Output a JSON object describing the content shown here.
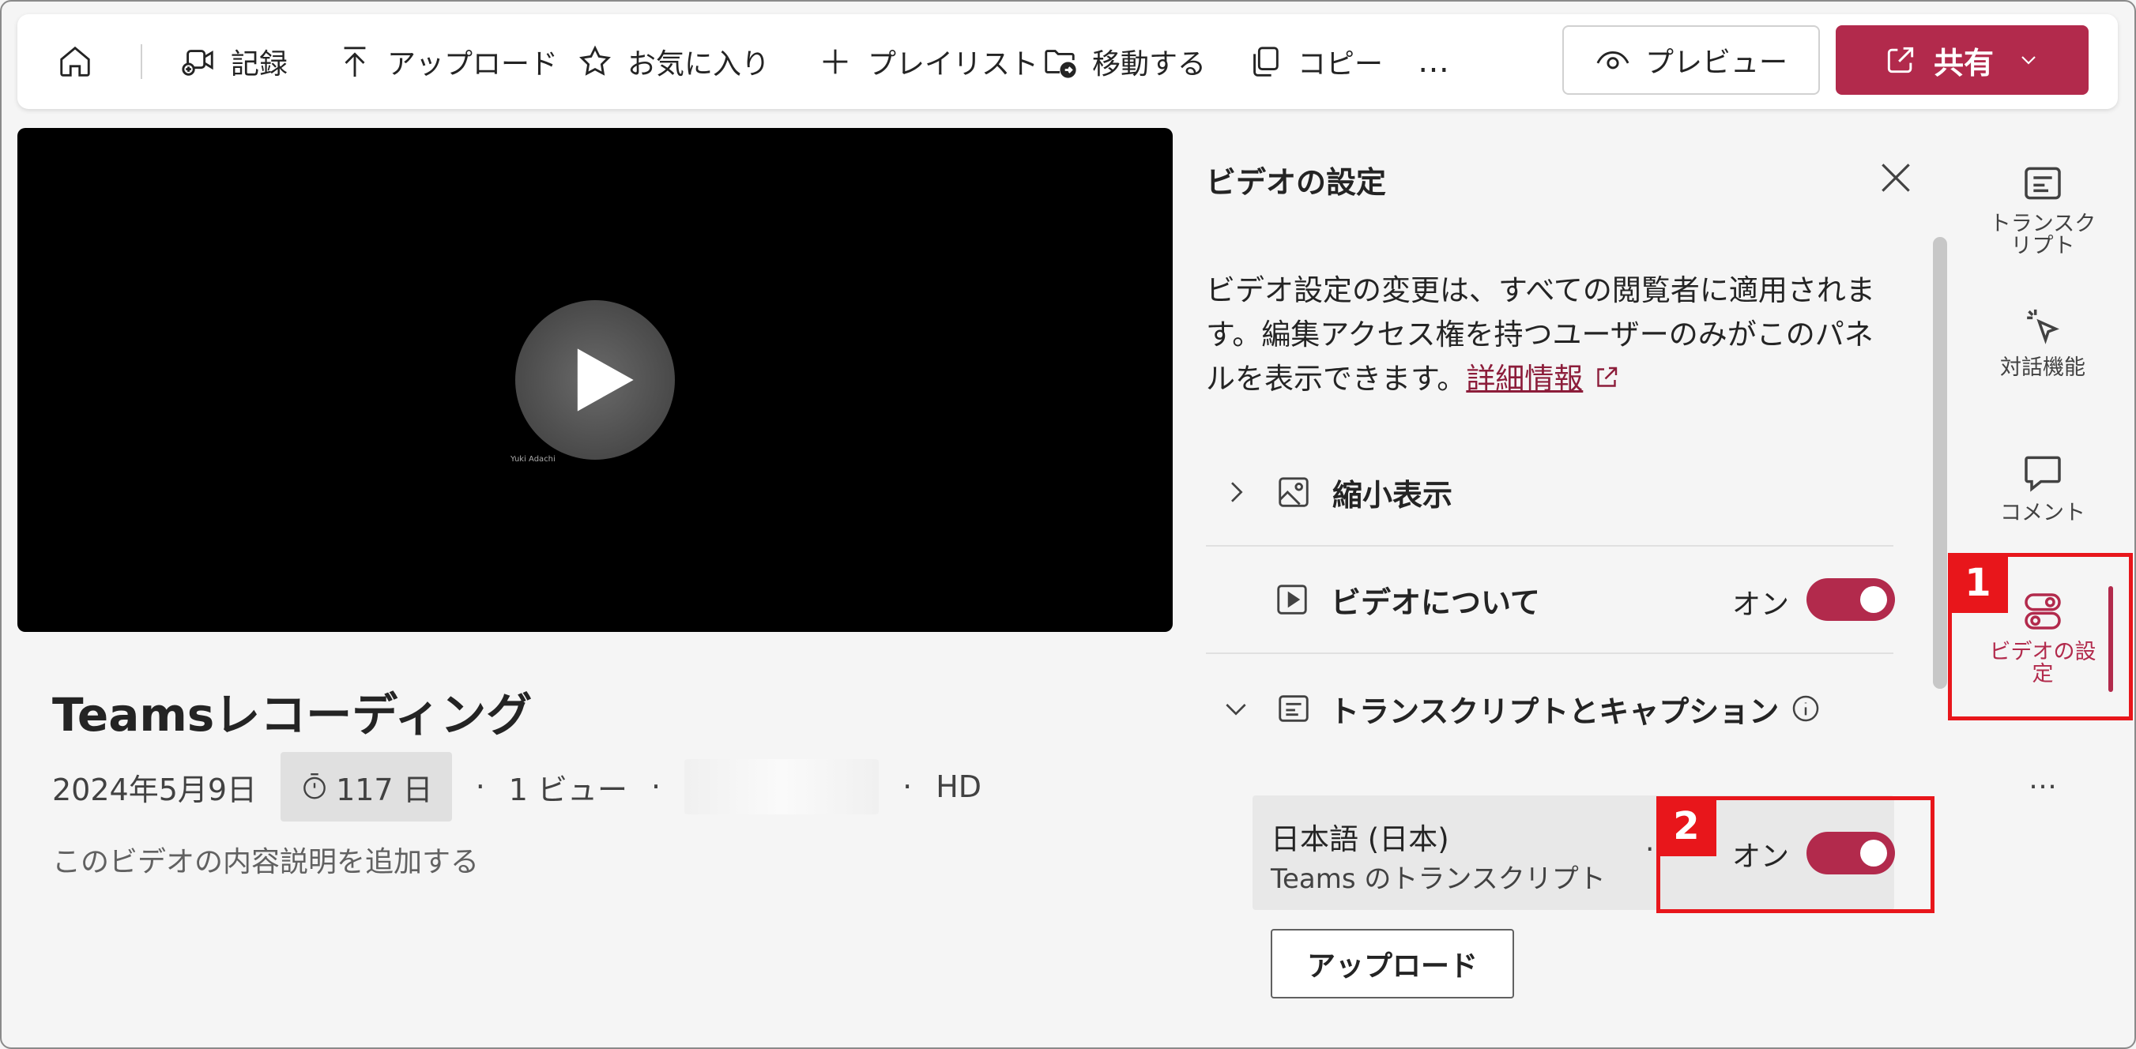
{
  "toolbar": {
    "record_label": "記録",
    "upload_label": "アップロード",
    "favorite_label": "お気に入り",
    "playlist_label": "プレイリスト",
    "move_label": "移動する",
    "copy_label": "コピー",
    "more_label": "…",
    "preview_label": "プレビュー",
    "share_label": "共有"
  },
  "video": {
    "speaker_name": "Yuki Adachi",
    "title": "Teamsレコーディング",
    "date": "2024年5月9日",
    "retention": "117 日",
    "views": "1 ビュー",
    "quality": "HD",
    "add_description": "このビデオの内容説明を追加する"
  },
  "panel": {
    "title": "ビデオの設定",
    "intro": "ビデオ設定の変更は、すべての閲覧者に適用されます。編集アクセス権を持つユーザーのみがこのパネルを表示できます。",
    "learn_more": "詳細情報",
    "sections": {
      "thumbnail": "縮小表示",
      "about": "ビデオについて",
      "about_state": "オン",
      "transcript": "トランスクリプトとキャプション"
    },
    "language": {
      "name": "日本語 (日本)",
      "source": "Teams のトランスクリプト",
      "separator": "·",
      "state": "オン"
    },
    "upload_button": "アップロード"
  },
  "rail": {
    "transcript": "トランスクリプト",
    "interactive": "対話機能",
    "comments": "コメント",
    "video_settings": "ビデオの設定",
    "more": "…"
  },
  "annotations": {
    "step1": "1",
    "step2": "2"
  },
  "colors": {
    "accent": "#b22a4c",
    "link": "#8c1d3a",
    "annotation": "#e8161b"
  }
}
